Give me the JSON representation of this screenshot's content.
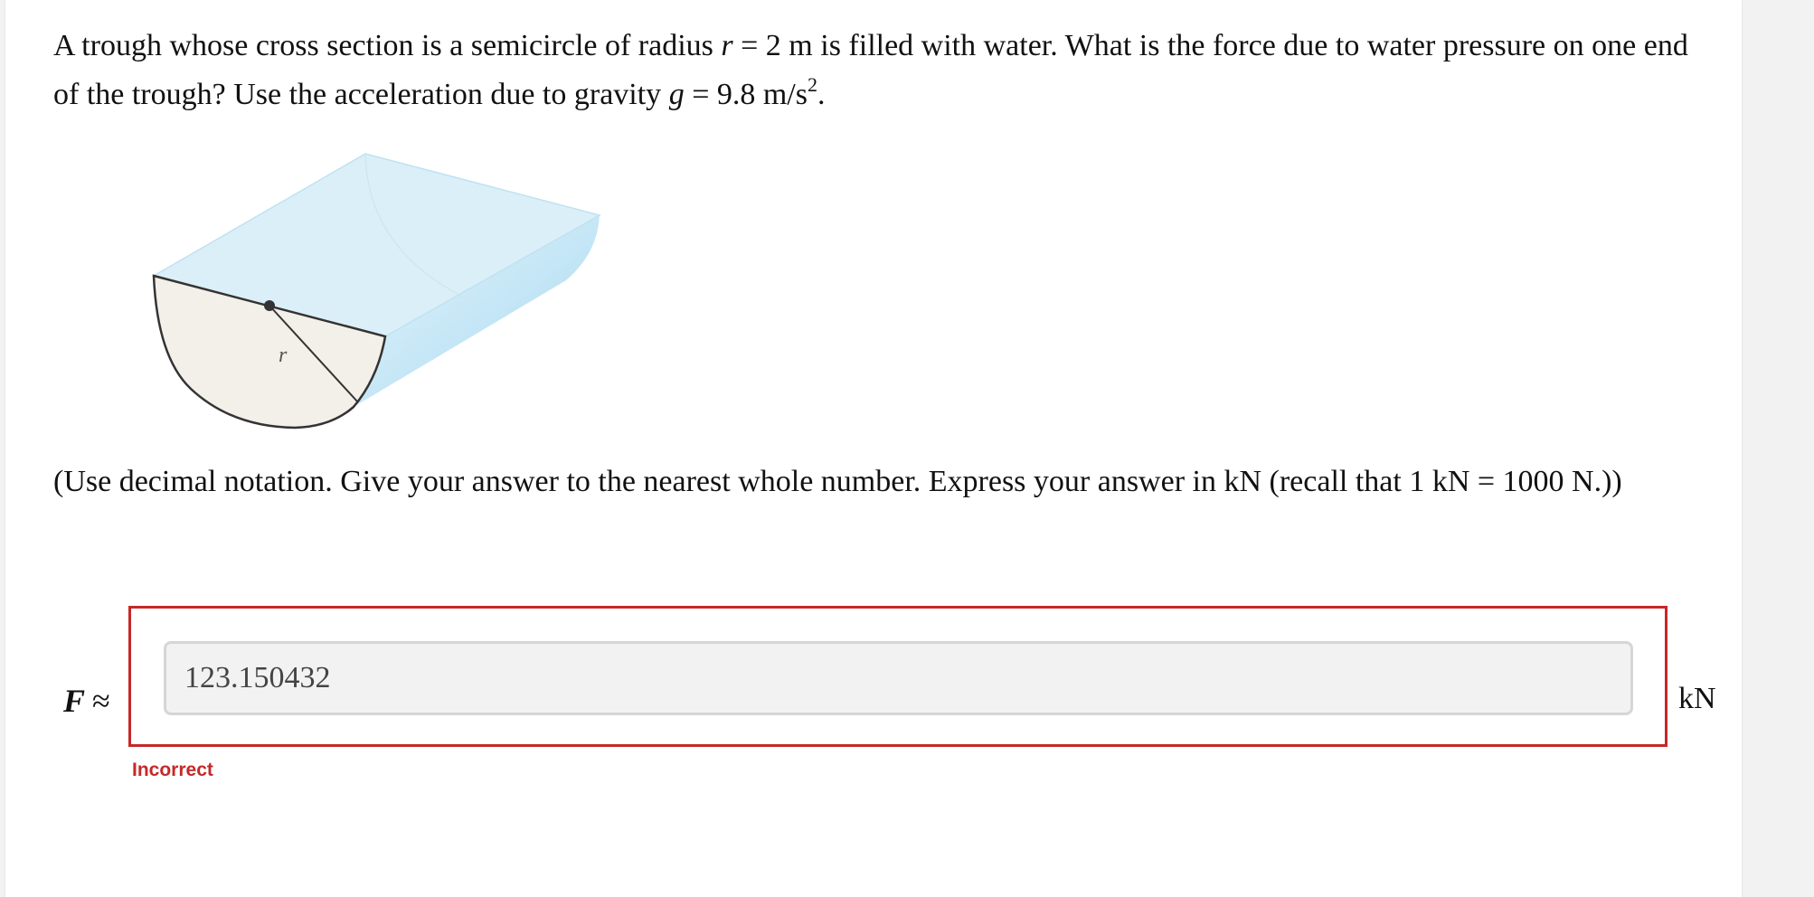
{
  "question": {
    "part1": "A trough whose cross section is a semicircle of radius",
    "var_r": "r",
    "eq1": " = 2 m is filled with water. What is the force due to water pressure on one end of the trough? Use the acceleration due to gravity",
    "var_g": "g",
    "eq2": " = 9.8 m/s",
    "exp": "2",
    "end": "."
  },
  "figure": {
    "radius_label": "r",
    "colors": {
      "water": "#dbeff8",
      "end_face": "#f3efe9",
      "outline": "#333333"
    }
  },
  "instructions": "(Use decimal notation. Give your answer to the nearest whole number. Express your answer in kN (recall that 1 kN = 1000 N.))",
  "answer": {
    "label_var": "F",
    "label_symbol": "≈",
    "value": "123.150432",
    "unit": "kN",
    "feedback": "Incorrect"
  },
  "colors": {
    "error": "#c62828"
  }
}
